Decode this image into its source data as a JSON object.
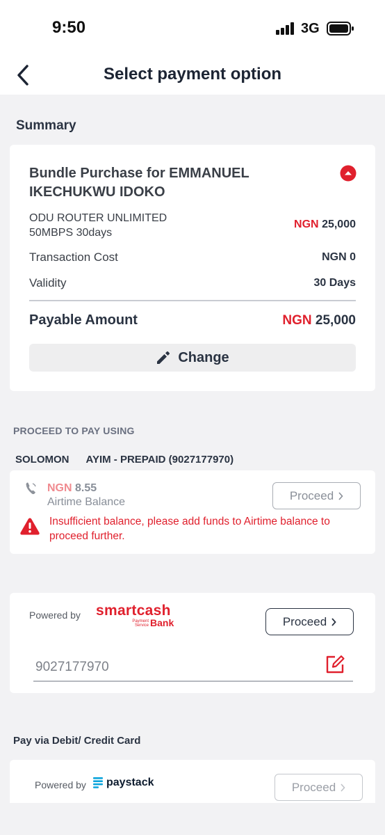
{
  "status_bar": {
    "time": "9:50",
    "network": "3G"
  },
  "header": {
    "title": "Select payment option"
  },
  "summary": {
    "section_title": "Summary",
    "bundle_title": "Bundle Purchase for EMMANUEL IKECHUKWU IDOKO",
    "plan_line1": "ODU ROUTER UNLIMITED",
    "plan_line2": "50MBPS 30days",
    "plan_currency": "NGN",
    "plan_amount": "25,000",
    "transaction_label": "Transaction Cost",
    "transaction_value": "NGN 0",
    "validity_label": "Validity",
    "validity_value": "30 Days",
    "payable_label": "Payable Amount",
    "payable_currency": "NGN",
    "payable_amount": "25,000",
    "change_label": "Change"
  },
  "proceed": {
    "section_title": "PROCEED TO PAY USING",
    "first_name": "SOLOMON",
    "account_rest": "AYIM  - PREPAID (9027177970)"
  },
  "airtime": {
    "currency": "NGN",
    "amount": "8.55",
    "label": "Airtime Balance",
    "proceed_label": "Proceed",
    "warning": "Insufficient balance, please add funds to Airtime balance to proceed further."
  },
  "smartcash": {
    "powered_by": "Powered by",
    "logo_text": "smartcash",
    "logo_sub1": "Payment",
    "logo_sub2": "Service",
    "logo_bank": "Bank",
    "proceed_label": "Proceed",
    "phone_value": "9027177970"
  },
  "card_payment": {
    "section_title": "Pay via Debit/ Credit Card",
    "powered_by": "Powered by",
    "logo_text": "paystack",
    "proceed_label": "Proceed"
  },
  "colors": {
    "accent_red": "#e0202d",
    "text_dark": "#2a3342",
    "background": "#f2f2f4"
  }
}
